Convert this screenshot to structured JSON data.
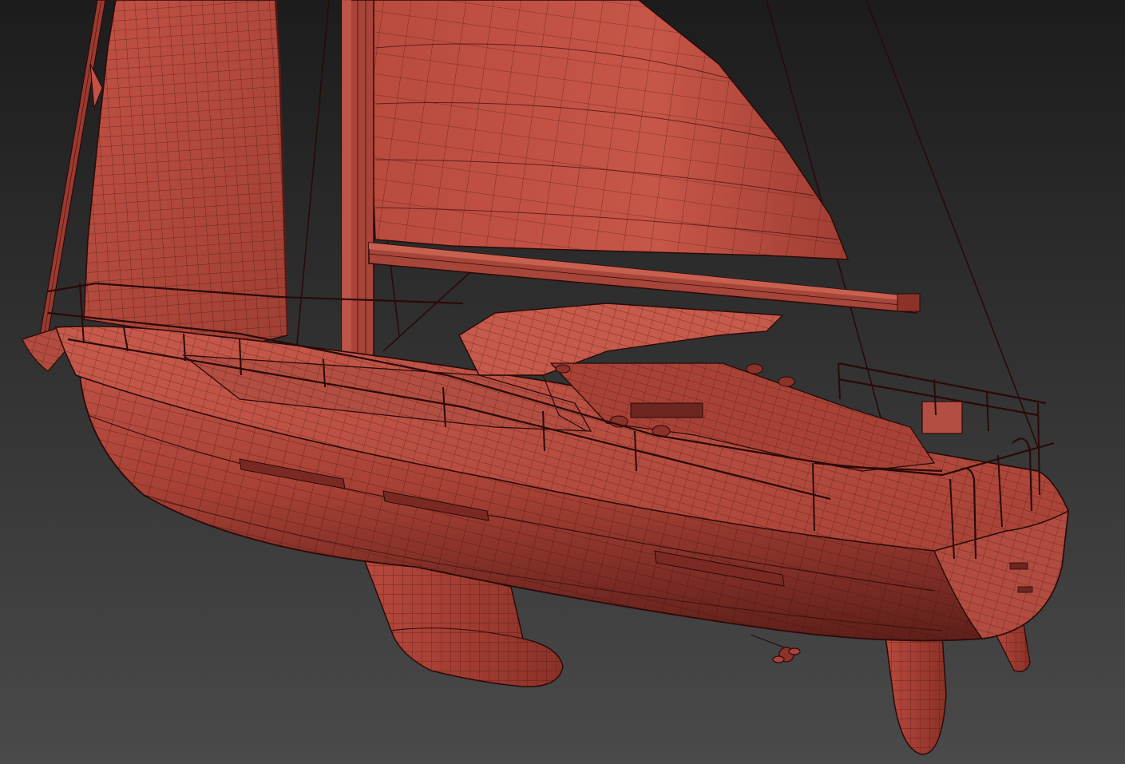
{
  "viewport": {
    "view": "perspective",
    "shading": "shaded-with-wireframe",
    "background_top": "#1c1c1c",
    "background_bottom": "#4a4a4a"
  },
  "model": {
    "subject": "sailboat",
    "material_color": "#b5483c",
    "material_shadow": "#6e2621",
    "material_highlight": "#d96a5a",
    "wire_color": "#3a0d0b",
    "parts": [
      "mainsail",
      "jib",
      "mast",
      "boom",
      "hull",
      "cabin",
      "cockpit",
      "railing",
      "keel",
      "rudder",
      "propeller"
    ]
  }
}
